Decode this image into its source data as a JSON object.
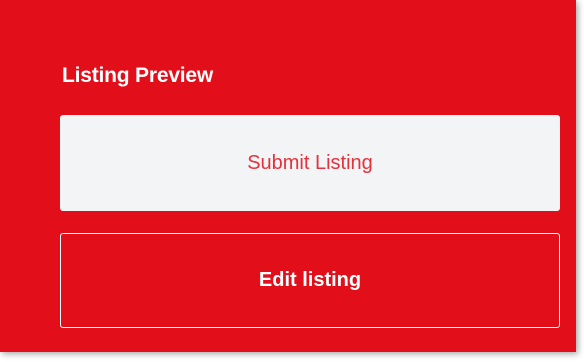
{
  "panel": {
    "title": "Listing Preview",
    "submit_label": "Submit Listing",
    "edit_label": "Edit listing"
  },
  "colors": {
    "panel_background": "#e20f1b",
    "submit_background": "#f3f4f6",
    "submit_text": "#e3323b",
    "edit_text": "#ffffff"
  }
}
